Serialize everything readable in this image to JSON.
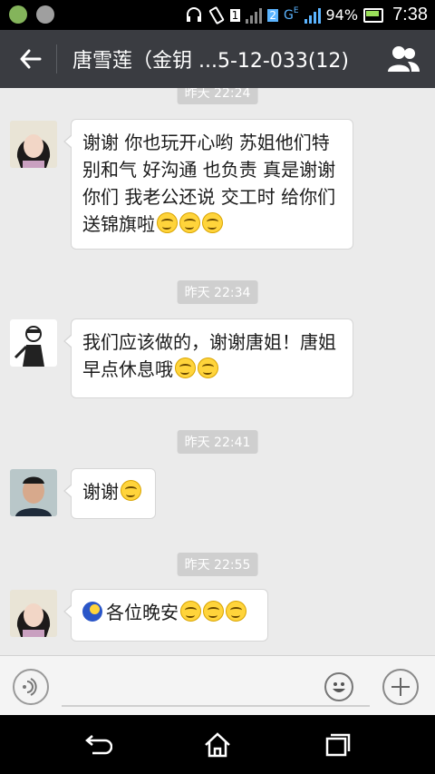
{
  "status_bar": {
    "network_labels": [
      "1",
      "2",
      "G",
      "E"
    ],
    "battery": "94%",
    "time": "7:38"
  },
  "header": {
    "title": "唐雪莲（金钥 ...5-12-033(12)"
  },
  "messages": [
    {
      "timestamp": "昨天 22:24",
      "text": "谢谢 你也玩开心哟 苏姐他们特别和气 好沟通 也负责 真是谢谢你们 我老公还说 交工时 给你们送锦旗啦",
      "emoji_count": 3
    },
    {
      "timestamp": "昨天 22:34",
      "text": "我们应该做的，谢谢唐姐！唐姐早点休息哦",
      "emoji_count": 2
    },
    {
      "timestamp": "昨天 22:41",
      "text": "谢谢",
      "emoji_count": 1
    },
    {
      "timestamp": "昨天 22:55",
      "text": "各位晚安",
      "emoji_count": 3
    }
  ],
  "colors": {
    "header_bg": "#3a3c41",
    "chat_bg": "#ebebeb",
    "timestamp_bg": "#cfcfcf"
  },
  "icons": {
    "back": "back-arrow-icon",
    "group": "group-members-icon",
    "voice": "voice-input-icon",
    "emoji": "emoji-icon",
    "plus": "plus-icon",
    "nav_back": "nav-back-icon",
    "nav_home": "nav-home-icon",
    "nav_recent": "nav-recent-apps-icon"
  }
}
